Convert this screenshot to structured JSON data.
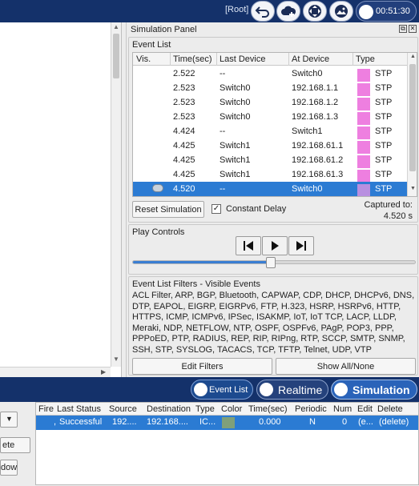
{
  "topbar": {
    "root_label": "[Root]",
    "clock": "00:51:30",
    "icons": [
      "back-arrow-icon",
      "cloud-add-icon",
      "move-arrows-icon",
      "image-icon",
      "clock-icon"
    ]
  },
  "sim_panel": {
    "title": "Simulation Panel",
    "event_list": {
      "label": "Event List",
      "columns": [
        "Vis.",
        "Time(sec)",
        "Last Device",
        "At Device",
        "Type"
      ],
      "rows": [
        {
          "vis": "",
          "time": "2.522",
          "last": "--",
          "at": "Switch0",
          "type": "STP"
        },
        {
          "vis": "",
          "time": "2.523",
          "last": "Switch0",
          "at": "192.168.1.1",
          "type": "STP"
        },
        {
          "vis": "",
          "time": "2.523",
          "last": "Switch0",
          "at": "192.168.1.2",
          "type": "STP"
        },
        {
          "vis": "",
          "time": "2.523",
          "last": "Switch0",
          "at": "192.168.1.3",
          "type": "STP"
        },
        {
          "vis": "",
          "time": "4.424",
          "last": "--",
          "at": "Switch1",
          "type": "STP"
        },
        {
          "vis": "",
          "time": "4.425",
          "last": "Switch1",
          "at": "192.168.61.1",
          "type": "STP"
        },
        {
          "vis": "",
          "time": "4.425",
          "last": "Switch1",
          "at": "192.168.61.2",
          "type": "STP"
        },
        {
          "vis": "",
          "time": "4.425",
          "last": "Switch1",
          "at": "192.168.61.3",
          "type": "STP"
        },
        {
          "vis": "eye",
          "time": "4.520",
          "last": "--",
          "at": "Switch0",
          "type": "STP",
          "selected": true
        }
      ],
      "reset_label": "Reset Simulation",
      "constant_delay_label": "Constant Delay",
      "constant_delay_checked": true,
      "captured_label": "Captured to:",
      "captured_value": "4.520 s"
    },
    "play_controls": {
      "label": "Play Controls",
      "progress": 0.49
    },
    "filters": {
      "label": "Event List Filters - Visible Events",
      "text": "ACL Filter, ARP, BGP, Bluetooth, CAPWAP, CDP, DHCP, DHCPv6, DNS, DTP, EAPOL, EIGRP, EIGRPv6, FTP, H.323, HSRP, HSRPv6, HTTP, HTTPS, ICMP, ICMPv6, IPSec, ISAKMP, IoT, IoT TCP, LACP, LLDP, Meraki, NDP, NETFLOW, NTP, OSPF, OSPFv6, PAgP, POP3, PPP, PPPoED, PTP, RADIUS, REP, RIP, RIPng, RTP, SCCP, SMTP, SNMP, SSH, STP, SYSLOG, TACACS, TCP, TFTP, Telnet, UDP, VTP",
      "edit_label": "Edit Filters",
      "show_all_label": "Show All/None"
    }
  },
  "mode_bar": {
    "event_list_label": "Event List",
    "realtime_label": "Realtime",
    "simulation_label": "Simulation"
  },
  "bottom": {
    "left_buttons": [
      "ete",
      "dow"
    ],
    "pdu_columns": [
      "Fire",
      "Last Status",
      "Source",
      "Destination",
      "Type",
      "Color",
      "Time(sec)",
      "Periodic",
      "Num",
      "Edit",
      "Delete"
    ],
    "pdu_rows": [
      {
        "fire": ",",
        "status": "Successful",
        "source": "192....",
        "dest": "192.168....",
        "type": "IC...",
        "color": "#7fa07a",
        "time": "0.000",
        "periodic": "N",
        "num": "0",
        "edit": "(e...",
        "delete": "(delete)"
      }
    ]
  }
}
